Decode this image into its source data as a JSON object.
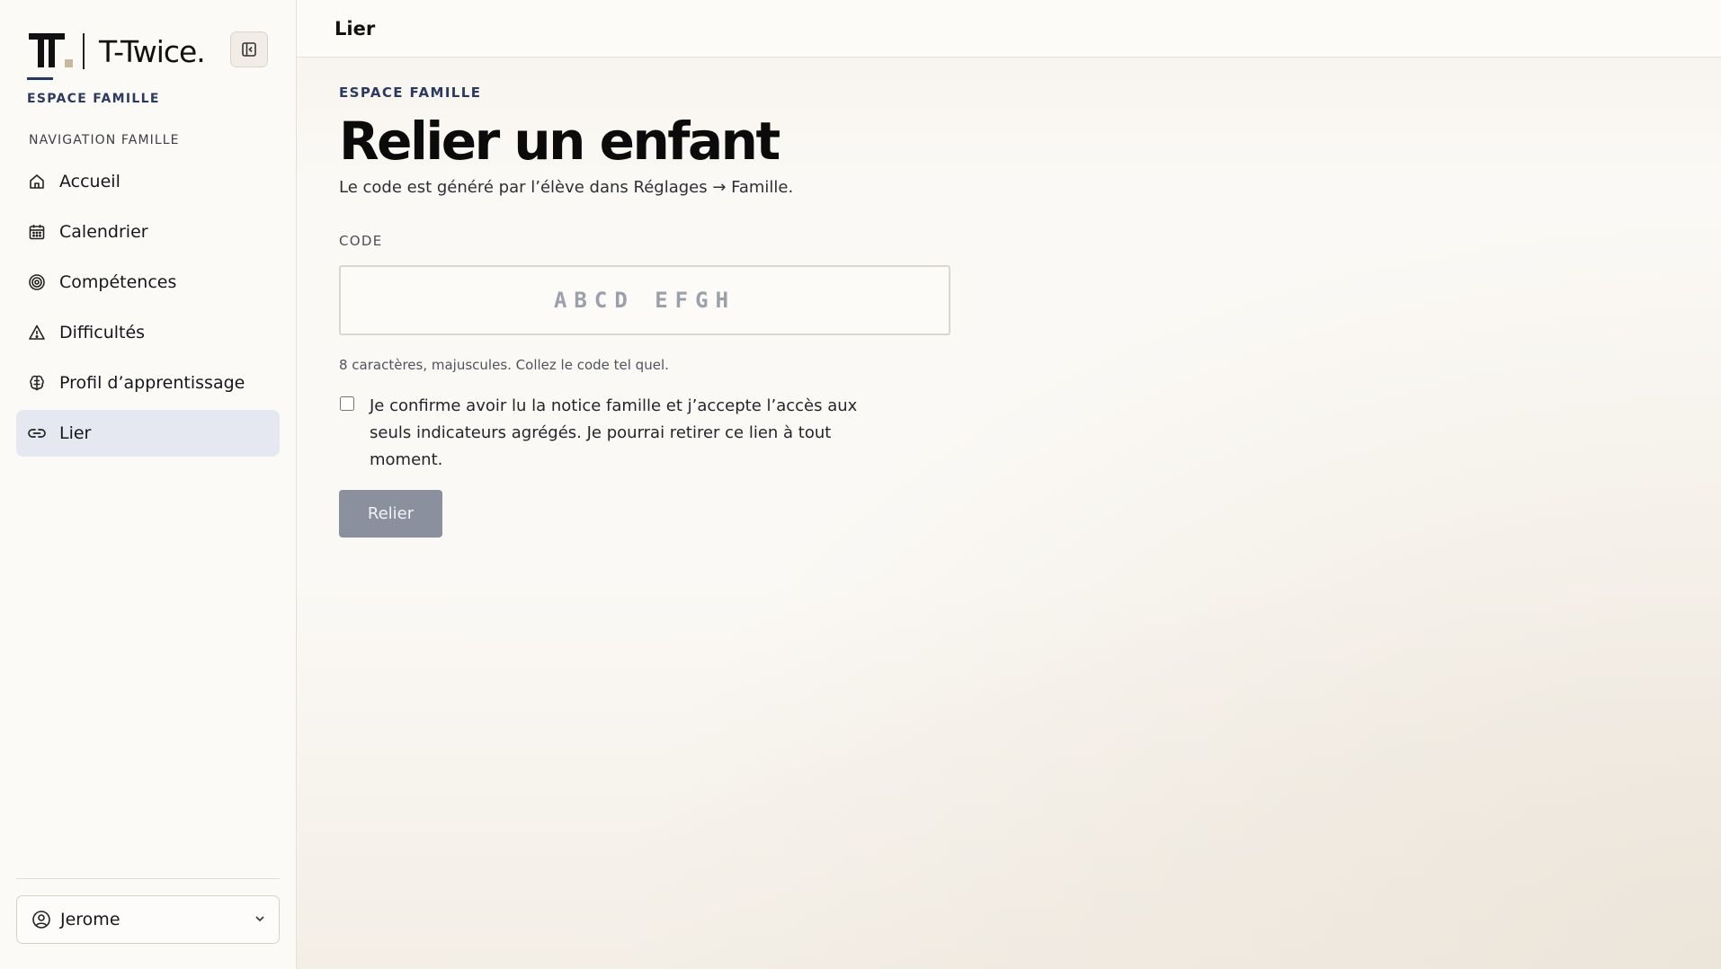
{
  "brand": {
    "name": "T-Twice."
  },
  "sidebar": {
    "section_title": "ESPACE FAMILLE",
    "nav_title": "NAVIGATION FAMILLE",
    "items": [
      {
        "label": "Accueil",
        "icon": "home-icon",
        "active": false
      },
      {
        "label": "Calendrier",
        "icon": "calendar-icon",
        "active": false
      },
      {
        "label": "Compétences",
        "icon": "target-icon",
        "active": false
      },
      {
        "label": "Difficultés",
        "icon": "warning-triangle-icon",
        "active": false
      },
      {
        "label": "Profil d’apprentissage",
        "icon": "brain-icon",
        "active": false
      },
      {
        "label": "Lier",
        "icon": "link-icon",
        "active": true
      }
    ],
    "user": {
      "name": "Jerome",
      "icon": "user-circle-icon"
    }
  },
  "topbar": {
    "title": "Lier"
  },
  "main": {
    "eyebrow": "ESPACE FAMILLE",
    "title": "Relier un enfant",
    "subtitle": "Le code est généré par l’élève dans Réglages → Famille.",
    "code_label": "CODE",
    "code_placeholder": "ABCD EFGH",
    "code_value": "",
    "hint": "8 caractères, majuscules. Collez le code tel quel.",
    "consent_text": "Je confirme avoir lu la notice famille et j’accepte l’accès aux seuls indicateurs agrégés. Je pourrai retirer ce lien à tout moment.",
    "consent_checked": false,
    "submit_label": "Relier"
  },
  "colors": {
    "accent_navy": "#2b3a5e",
    "active_nav_bg": "#e5e8f1",
    "disabled_button": "#8a909e"
  }
}
